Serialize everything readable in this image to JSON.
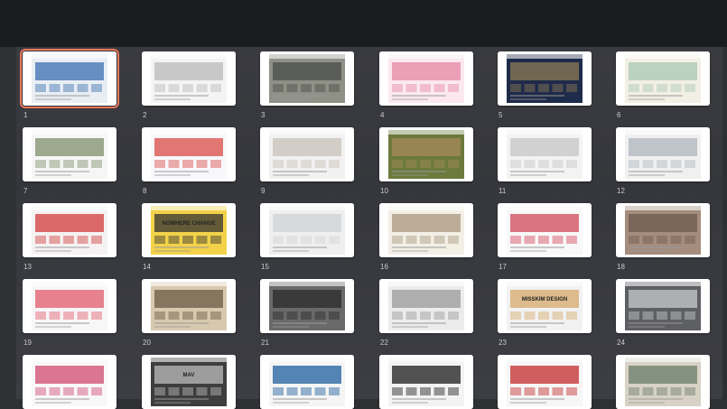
{
  "slides": [
    {
      "number": "1",
      "thumb_icon": "webpage-thumbnail-icon",
      "selected": true
    },
    {
      "number": "2",
      "thumb_icon": "webpage-thumbnail-icon"
    },
    {
      "number": "3",
      "thumb_icon": "webpage-thumbnail-icon"
    },
    {
      "number": "4",
      "thumb_icon": "webpage-thumbnail-icon"
    },
    {
      "number": "5",
      "thumb_icon": "webpage-thumbnail-icon"
    },
    {
      "number": "6",
      "thumb_icon": "webpage-thumbnail-icon"
    },
    {
      "number": "7",
      "thumb_icon": "webpage-thumbnail-icon"
    },
    {
      "number": "8",
      "thumb_icon": "webpage-thumbnail-icon"
    },
    {
      "number": "9",
      "thumb_icon": "webpage-thumbnail-icon"
    },
    {
      "number": "10",
      "thumb_icon": "webpage-thumbnail-icon"
    },
    {
      "number": "11",
      "thumb_icon": "webpage-thumbnail-icon"
    },
    {
      "number": "12",
      "thumb_icon": "webpage-thumbnail-icon"
    },
    {
      "number": "13",
      "thumb_icon": "webpage-thumbnail-icon"
    },
    {
      "number": "14",
      "thumb_icon": "webpage-thumbnail-icon",
      "text": "NOWHERE CHANGE"
    },
    {
      "number": "15",
      "thumb_icon": "webpage-thumbnail-icon"
    },
    {
      "number": "16",
      "thumb_icon": "webpage-thumbnail-icon"
    },
    {
      "number": "17",
      "thumb_icon": "webpage-thumbnail-icon"
    },
    {
      "number": "18",
      "thumb_icon": "webpage-thumbnail-icon"
    },
    {
      "number": "19",
      "thumb_icon": "webpage-thumbnail-icon"
    },
    {
      "number": "20",
      "thumb_icon": "webpage-thumbnail-icon"
    },
    {
      "number": "21",
      "thumb_icon": "webpage-thumbnail-icon"
    },
    {
      "number": "22",
      "thumb_icon": "webpage-thumbnail-icon"
    },
    {
      "number": "23",
      "thumb_icon": "webpage-thumbnail-icon",
      "text": "MISSKIM DESIGN"
    },
    {
      "number": "24",
      "thumb_icon": "webpage-thumbnail-icon"
    },
    {
      "number": "",
      "thumb_icon": "webpage-thumbnail-icon"
    },
    {
      "number": "",
      "thumb_icon": "webpage-thumbnail-icon",
      "text": "MAV"
    },
    {
      "number": "",
      "thumb_icon": "webpage-thumbnail-icon"
    },
    {
      "number": "",
      "thumb_icon": "webpage-thumbnail-icon"
    },
    {
      "number": "",
      "thumb_icon": "webpage-thumbnail-icon"
    },
    {
      "number": "",
      "thumb_icon": "webpage-thumbnail-icon"
    }
  ],
  "colors": {
    "selection": "#e8775a",
    "background": "#2f3034"
  }
}
